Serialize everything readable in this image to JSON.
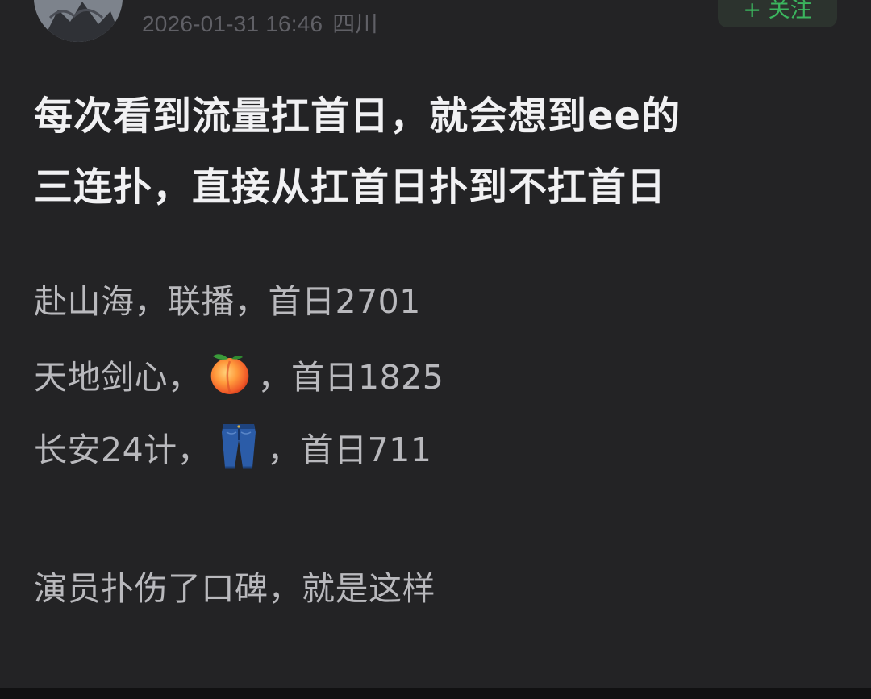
{
  "author": {
    "timestamp": "2026-01-31 16:46",
    "location": "四川"
  },
  "follow_button": {
    "label": "+ 关注"
  },
  "post": {
    "title_lines": [
      "每次看到流量扛首日，就会想到ee的",
      "三连扑，直接从扛首日扑到不扛首日"
    ],
    "items": [
      {
        "before": "赴山海，联播，首日2701",
        "emoji": null,
        "after": ""
      },
      {
        "before": "天地剑心，",
        "emoji": "peach-icon",
        "after": "，首日1825"
      },
      {
        "before": "长安24计，",
        "emoji": "jeans-icon",
        "after": "，首日711"
      }
    ],
    "closing": "演员扑伤了口碑，就是这样"
  },
  "colors": {
    "background": "#232325",
    "title": "#f1f1f3",
    "body": "#b9b9bd",
    "meta": "#606066",
    "follow_text": "#3bb55e",
    "follow_bg": "#2c332e"
  }
}
